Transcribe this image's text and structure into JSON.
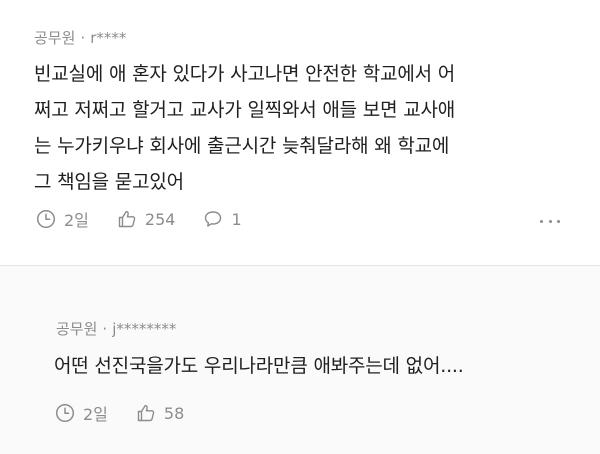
{
  "comments": [
    {
      "author": "공무원",
      "separator": "·",
      "user": "r****",
      "lines": [
        "빈교실에 애 혼자 있다가 사고나면 안전한 학교에서 어",
        "쩌고 저쩌고 할거고 교사가 일찍와서 애들 보면 교사애",
        "는 누가키우냐 회사에 출근시간 늦춰달라해 왜 학교에",
        "그 책임을 묻고있어"
      ],
      "time": "2일",
      "likes": "254",
      "replies": "1",
      "icons": {
        "time": "clock-icon",
        "likes": "thumbs-up-icon",
        "replies": "speech-bubble-icon",
        "more": "more-dots-icon"
      }
    }
  ],
  "reply": {
    "author": "공무원",
    "separator": "·",
    "user": "j********",
    "text": "어떤 선진국을가도 우리나라만큼 애봐주는데 없어....",
    "time": "2일",
    "likes": "58",
    "icons": {
      "time": "clock-icon",
      "likes": "thumbs-up-icon"
    }
  },
  "colors": {
    "meta": "#8c8c8c",
    "text": "#1f1f1f",
    "reply_background": "#fafafa",
    "divider": "#e6e6e6"
  }
}
